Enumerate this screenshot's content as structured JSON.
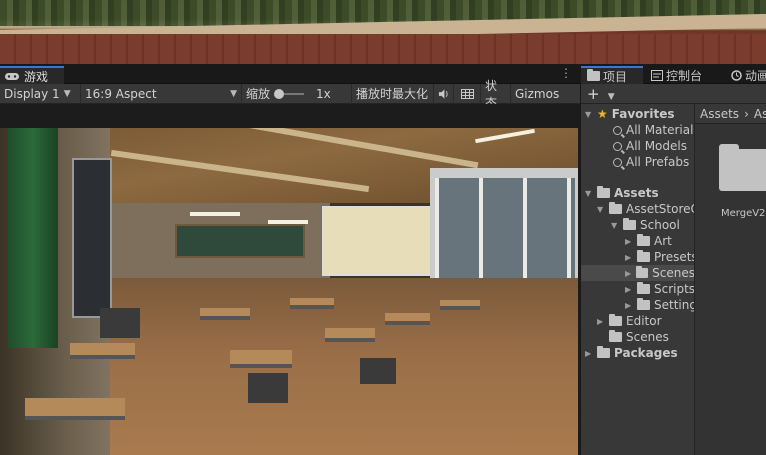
{
  "game_panel": {
    "tab_label": "游戏",
    "tab_icon": "gamepad-icon",
    "menu_icon": "kebab-menu-icon",
    "display_select": "Display 1",
    "aspect_select": "16:9 Aspect",
    "scale_label": "缩放",
    "scale_value": "1x",
    "maximize_label": "播放时最大化",
    "audio_icon": "speaker-icon",
    "stats_icon": "stats-grid-icon",
    "state_label": "状态",
    "gizmos_label": "Gizmos"
  },
  "project_panel": {
    "tabs": [
      {
        "label": "项目",
        "icon": "folder-icon",
        "active": true
      },
      {
        "label": "控制台",
        "icon": "console-icon",
        "active": false
      },
      {
        "label": "动画",
        "icon": "clock-icon",
        "active": false
      }
    ],
    "add_button": "+",
    "favorites": {
      "label": "Favorites",
      "items": [
        "All Material",
        "All Models",
        "All Prefabs"
      ]
    },
    "assets_root": "Assets",
    "tree": [
      {
        "label": "AssetStoreO",
        "level": 1,
        "expanded": true
      },
      {
        "label": "School",
        "level": 2,
        "expanded": true
      },
      {
        "label": "Art",
        "level": 3,
        "expanded": false
      },
      {
        "label": "Presets",
        "level": 3,
        "expanded": false
      },
      {
        "label": "Scenes",
        "level": 3,
        "expanded": false,
        "selected": true
      },
      {
        "label": "Scripts",
        "level": 3,
        "expanded": false
      },
      {
        "label": "Settings",
        "level": 3,
        "expanded": false
      },
      {
        "label": "Editor",
        "level": 1,
        "expanded": false
      },
      {
        "label": "Scenes",
        "level": 1,
        "expanded": null
      }
    ],
    "packages_label": "Packages",
    "breadcrumb": [
      "Assets",
      "As"
    ],
    "grid_item_label": "MergeV2"
  }
}
